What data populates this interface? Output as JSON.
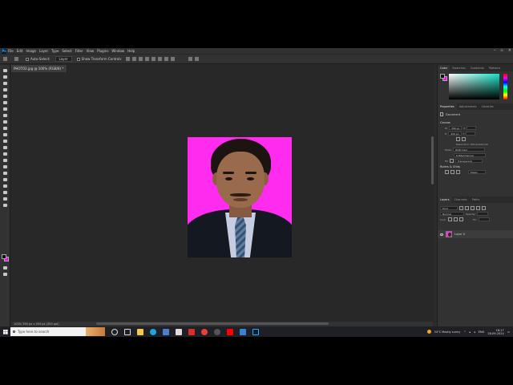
{
  "menubar": {
    "logo": "Ps",
    "items": [
      "File",
      "Edit",
      "Image",
      "Layer",
      "Type",
      "Select",
      "Filter",
      "View",
      "Plugins",
      "Window",
      "Help"
    ]
  },
  "options": {
    "auto_select_label": "Auto-Select:",
    "auto_select_value": "Layer",
    "transform_label": "Show Transform Controls"
  },
  "document": {
    "tab_title": "PHOTO2.jpg @ 100% (RGB/8) *",
    "status": "100%      390 px x 450 px (300 ppi)"
  },
  "panels": {
    "color_tabs": [
      "Color",
      "Swatches",
      "Gradients",
      "Patterns"
    ],
    "props_tabs": [
      "Properties",
      "Adjustments",
      "Libraries"
    ],
    "props_doc": "Document",
    "canvas_section": "Canvas",
    "width_label": "W",
    "width_value": "390 px",
    "height_label": "H",
    "height_value": "450 px",
    "x_label": "X",
    "y_label": "Y",
    "resolution": "Resolution: 300 pixels/inch",
    "mode_label": "Mode",
    "mode_value": "RGB Color",
    "bit_depth": "8 Bits/Channel",
    "fill_label": "Fill",
    "fill_value": "Transparent",
    "rulers_section": "Rulers & Grids",
    "units_value": "Pixels",
    "layers_tabs": [
      "Layers",
      "Channels",
      "Paths"
    ],
    "kind_value": "Kind",
    "mode_dropdown": "Normal",
    "opacity_label": "Opacity:",
    "lock_label": "Lock:",
    "fill2_label": "Fill:",
    "layer_name": "Layer 0"
  },
  "taskbar": {
    "search_placeholder": "Type here to search",
    "weather": "34°C  Mostly sunny",
    "lang": "ENG",
    "time": "18:17",
    "date": "28-09-2024"
  },
  "colors": {
    "canvas_bg": "#ff2bef",
    "foreground": "#111111",
    "background": "#ff00ff"
  }
}
